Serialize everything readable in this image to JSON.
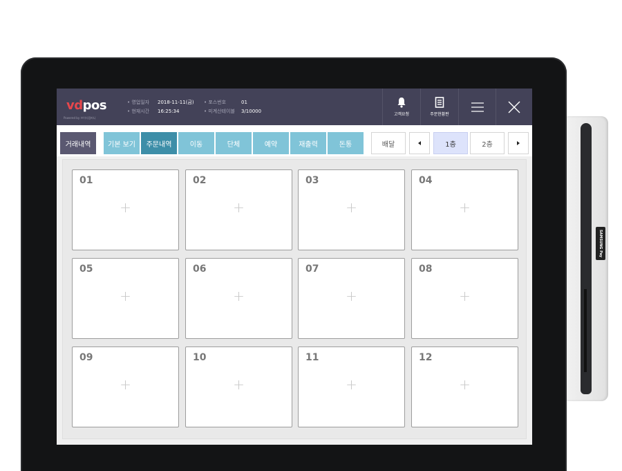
{
  "header": {
    "logo_vd": "vd",
    "logo_pos": "pos",
    "logo_sub": "Powered by 브이디컴퍼니",
    "info_left": [
      {
        "label": "• 영업일자",
        "value": "2018-11-11(금)"
      },
      {
        "label": "• 현재시간",
        "value": "16:25:34"
      }
    ],
    "info_right": [
      {
        "label": "• 포스번호",
        "value": "01"
      },
      {
        "label": "• 미계산테이블",
        "value": "3/10000"
      }
    ],
    "buttons": {
      "customer_request": {
        "label": "고객요청",
        "icon": "bell-icon"
      },
      "order_status": {
        "label": "주문현황판",
        "icon": "receipt-icon"
      },
      "menu": {
        "icon": "hamburger-menu-icon"
      },
      "close": {
        "icon": "close-icon"
      }
    }
  },
  "toolbar": {
    "history": "거래내역",
    "tabs": [
      "기본 보기",
      "주문내역",
      "이동",
      "단체",
      "예약",
      "재출력",
      "돈통"
    ],
    "active_tab": "주문내역",
    "delivery": "배달",
    "floors": [
      "1층",
      "2층"
    ],
    "selected_floor": "1층"
  },
  "tables": [
    {
      "number": "01",
      "plus": "+"
    },
    {
      "number": "02",
      "plus": "+"
    },
    {
      "number": "03",
      "plus": "+"
    },
    {
      "number": "04",
      "plus": "+"
    },
    {
      "number": "05",
      "plus": "+"
    },
    {
      "number": "06",
      "plus": "+"
    },
    {
      "number": "07",
      "plus": "+"
    },
    {
      "number": "08",
      "plus": "+"
    },
    {
      "number": "09",
      "plus": "+"
    },
    {
      "number": "10",
      "plus": "+"
    },
    {
      "number": "11",
      "plus": "+"
    },
    {
      "number": "12",
      "plus": "+"
    }
  ],
  "device": {
    "reader_badge": "SAMSUNG Pay"
  },
  "colors": {
    "header_bg": "#434258",
    "logo_accent": "#e8474c",
    "tab_light": "#80c4d8",
    "tab_active": "#3d8ea8",
    "floor_selected": "#dde3fb"
  }
}
